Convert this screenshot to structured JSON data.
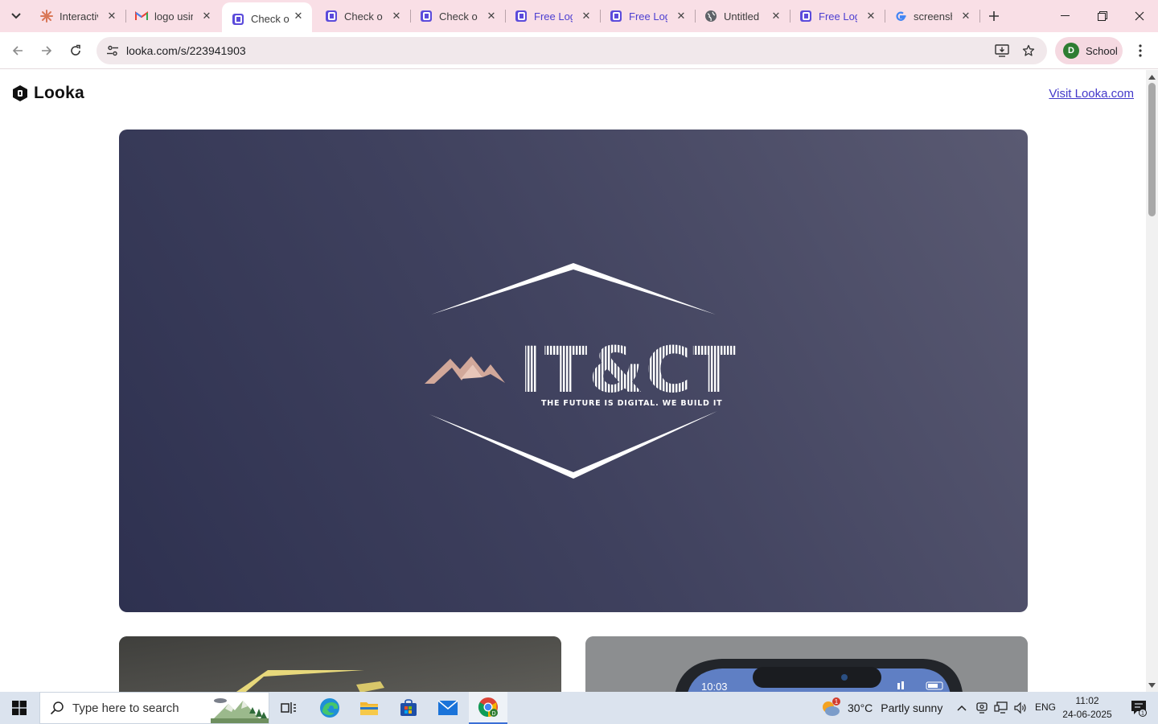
{
  "browser": {
    "tabs": [
      {
        "title": "Interactiv",
        "favicon": "claude-icon"
      },
      {
        "title": "logo usin",
        "favicon": "gmail-icon"
      },
      {
        "title": "Check ou",
        "favicon": "looka-icon",
        "active": true
      },
      {
        "title": "Check ou",
        "favicon": "looka-icon"
      },
      {
        "title": "Check ou",
        "favicon": "looka-icon"
      },
      {
        "title": "Free Log",
        "favicon": "looka-icon"
      },
      {
        "title": "Free Log",
        "favicon": "looka-icon"
      },
      {
        "title": "Untitled",
        "favicon": "globe-icon"
      },
      {
        "title": "Free Log",
        "favicon": "looka-icon"
      },
      {
        "title": "screensh",
        "favicon": "google-icon"
      }
    ],
    "url": "looka.com/s/223941903",
    "profile": {
      "initial": "D",
      "label": "School"
    }
  },
  "page": {
    "brand": "Looka",
    "visit_link": "Visit Looka.com",
    "logo": {
      "name": "IT&CT",
      "slogan": "THE FUTURE IS DIGITAL. WE BUILD IT"
    },
    "phone_mockup_time": "10:03"
  },
  "taskbar": {
    "search_placeholder": "Type here to search",
    "weather": {
      "badge": "1",
      "temp": "30°C",
      "desc": "Partly sunny"
    },
    "language": "ENG",
    "time": "11:02",
    "date": "24-06-2025",
    "notification_count": "1"
  },
  "colors": {
    "tabstrip": "#f9dfe6",
    "hero_gradient_start": "#2e3150",
    "hero_gradient_end": "#5a5a72",
    "mountain": "#d2a89a",
    "link": "#4338ca",
    "looka_purple": "#5b4bdb"
  }
}
